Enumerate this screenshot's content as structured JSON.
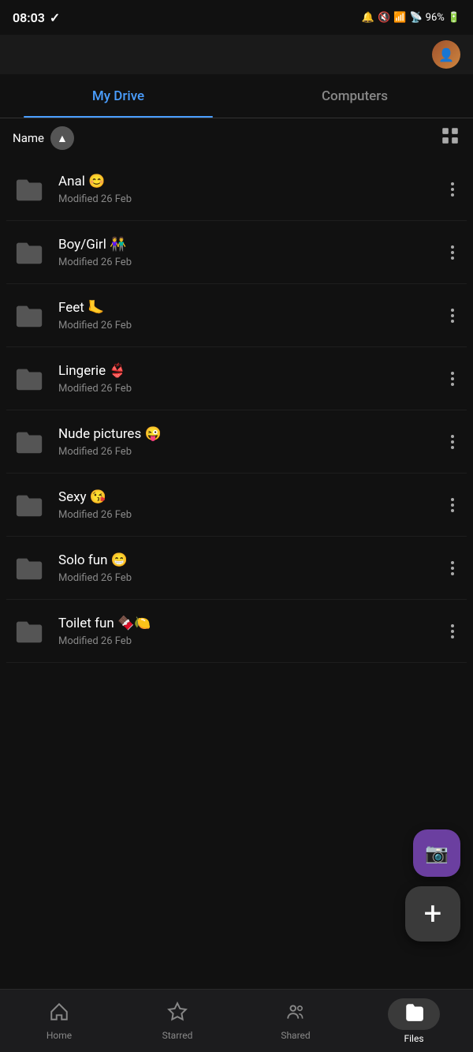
{
  "statusBar": {
    "time": "08:03",
    "checkIcon": "✓",
    "batteryLevel": "96%",
    "signalIcons": "🔔 📶"
  },
  "tabs": [
    {
      "id": "myDrive",
      "label": "My Drive",
      "active": true
    },
    {
      "id": "computers",
      "label": "Computers",
      "active": false
    }
  ],
  "sortBar": {
    "label": "Name",
    "gridIconLabel": "⊞"
  },
  "files": [
    {
      "name": "Anal 😊",
      "modified": "Modified 26 Feb"
    },
    {
      "name": "Boy/Girl 👫",
      "modified": "Modified 26 Feb"
    },
    {
      "name": "Feet 🦶",
      "modified": "Modified 26 Feb"
    },
    {
      "name": "Lingerie 👙",
      "modified": "Modified 26 Feb"
    },
    {
      "name": "Nude pictures 😜",
      "modified": "Modified 26 Feb"
    },
    {
      "name": "Sexy 😘",
      "modified": "Modified 26 Feb"
    },
    {
      "name": "Solo fun 😁",
      "modified": "Modified 26 Feb"
    },
    {
      "name": "Toilet fun 🍫🍋",
      "modified": "Modified 26 Feb"
    }
  ],
  "navItems": [
    {
      "id": "home",
      "label": "Home",
      "icon": "🏠",
      "active": false
    },
    {
      "id": "starred",
      "label": "Starred",
      "icon": "☆",
      "active": false
    },
    {
      "id": "shared",
      "label": "Shared",
      "icon": "👤",
      "active": false
    },
    {
      "id": "files",
      "label": "Files",
      "icon": "📁",
      "active": true
    }
  ],
  "systemNav": {
    "backBtn": "|||",
    "homeBtn": "○",
    "recentBtn": "□"
  }
}
